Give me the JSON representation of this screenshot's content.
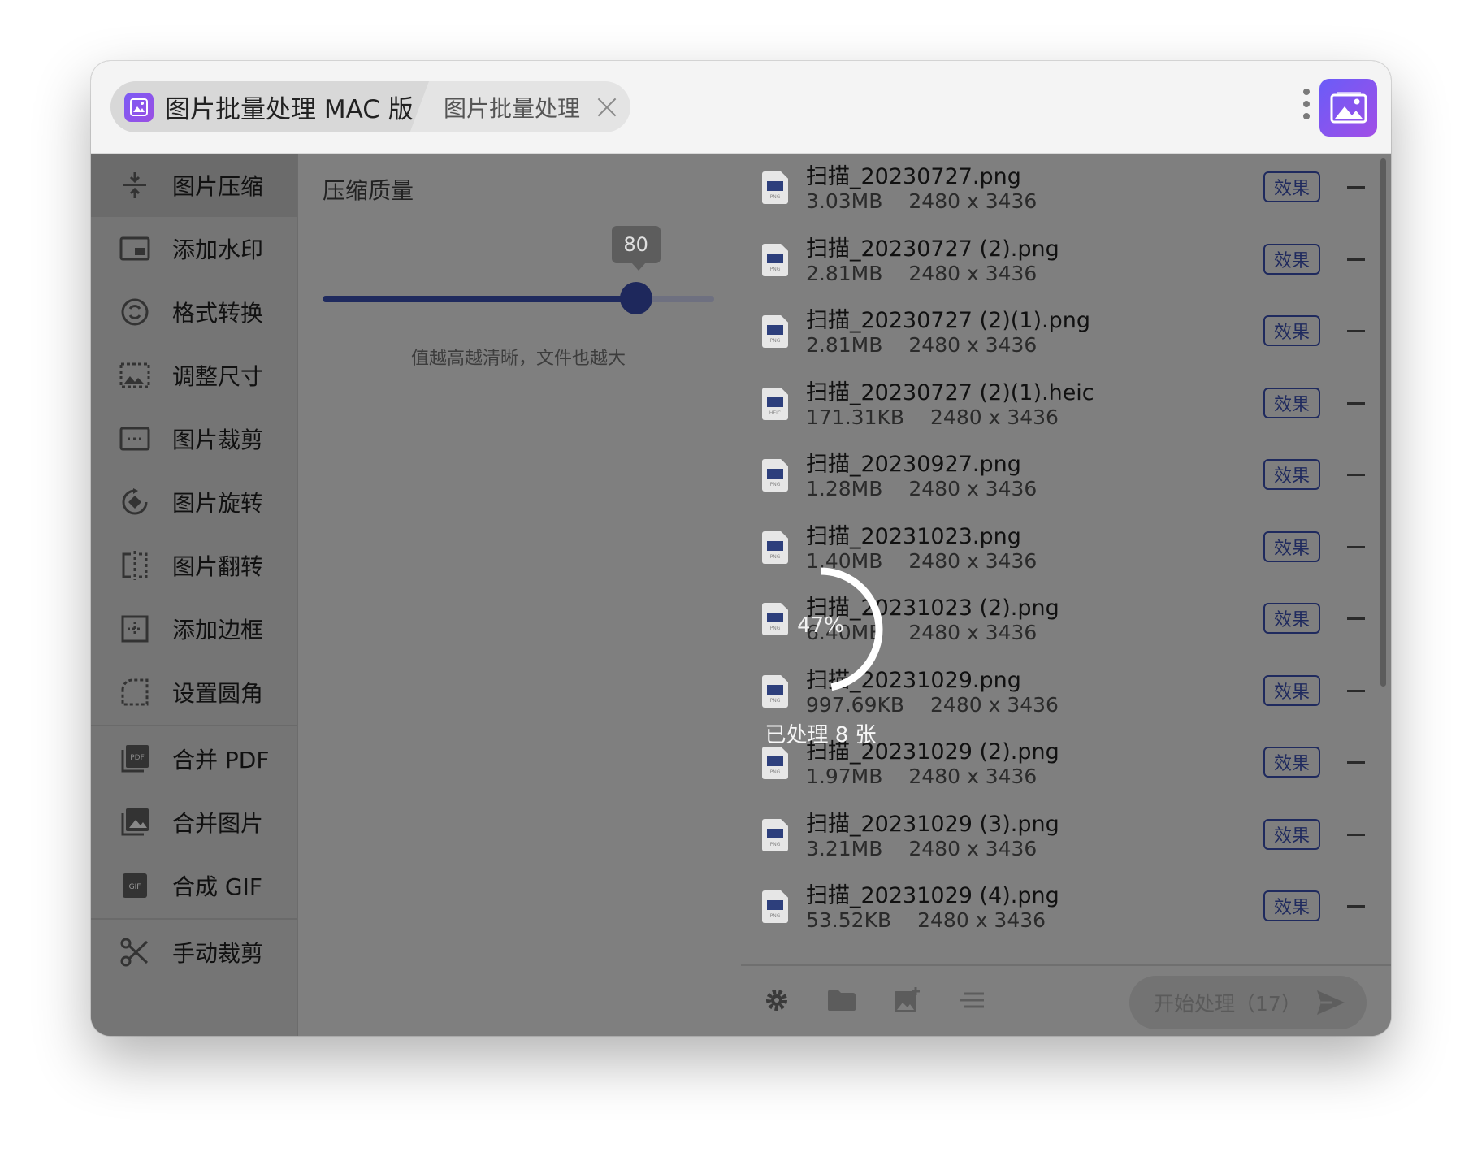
{
  "titlebar": {
    "app_tab_label": "图片批量处理 MAC 版",
    "second_tab_label": "图片批量处理"
  },
  "sidebar": {
    "items": [
      {
        "label": "图片压缩",
        "icon": "compress-icon",
        "active": true
      },
      {
        "label": "添加水印",
        "icon": "watermark-icon"
      },
      {
        "label": "格式转换",
        "icon": "convert-icon"
      },
      {
        "label": "调整尺寸",
        "icon": "resize-icon"
      },
      {
        "label": "图片裁剪",
        "icon": "crop-icon"
      },
      {
        "label": "图片旋转",
        "icon": "rotate-icon"
      },
      {
        "label": "图片翻转",
        "icon": "flip-icon"
      },
      {
        "label": "添加边框",
        "icon": "border-icon"
      },
      {
        "label": "设置圆角",
        "icon": "rounded-corner-icon"
      },
      {
        "label": "合并 PDF",
        "icon": "pdf-icon"
      },
      {
        "label": "合并图片",
        "icon": "merge-images-icon"
      },
      {
        "label": "合成 GIF",
        "icon": "gif-icon"
      },
      {
        "label": "手动裁剪",
        "icon": "scissors-icon"
      }
    ]
  },
  "panel": {
    "title": "压缩质量",
    "quality_value": "80",
    "quality_fraction": 0.8,
    "hint": "值越高越清晰，文件也越大"
  },
  "files": [
    {
      "name": "扫描_20230727.png",
      "size": "3.03MB",
      "dims": "2480 x 3436",
      "ext": "PNG"
    },
    {
      "name": "扫描_20230727 (2).png",
      "size": "2.81MB",
      "dims": "2480 x 3436",
      "ext": "PNG"
    },
    {
      "name": "扫描_20230727 (2)(1).png",
      "size": "2.81MB",
      "dims": "2480 x 3436",
      "ext": "PNG"
    },
    {
      "name": "扫描_20230727 (2)(1).heic",
      "size": "171.31KB",
      "dims": "2480 x 3436",
      "ext": "HEIC"
    },
    {
      "name": "扫描_20230927.png",
      "size": "1.28MB",
      "dims": "2480 x 3436",
      "ext": "PNG"
    },
    {
      "name": "扫描_20231023.png",
      "size": "1.40MB",
      "dims": "2480 x 3436",
      "ext": "PNG"
    },
    {
      "name": "扫描_20231023 (2).png",
      "size": "6.40MB",
      "dims": "2480 x 3436",
      "ext": "PNG"
    },
    {
      "name": "扫描_20231029.png",
      "size": "997.69KB",
      "dims": "2480 x 3436",
      "ext": "PNG"
    },
    {
      "name": "扫描_20231029 (2).png",
      "size": "1.97MB",
      "dims": "2480 x 3436",
      "ext": "PNG"
    },
    {
      "name": "扫描_20231029 (3).png",
      "size": "3.21MB",
      "dims": "2480 x 3436",
      "ext": "PNG"
    },
    {
      "name": "扫描_20231029 (4).png",
      "size": "53.52KB",
      "dims": "2480 x 3436",
      "ext": "PNG"
    }
  ],
  "file_effect_label": "效果",
  "bottom": {
    "start_label": "开始处理（17）",
    "tools": [
      "gear-icon",
      "folder-icon",
      "add-image-icon",
      "list-icon"
    ]
  },
  "progress": {
    "percent": "47%",
    "fraction": 0.47,
    "processed_label": "已处理 8 张"
  },
  "colors": {
    "accent": "#1f2a5e",
    "overlay": "#7f7f7f",
    "brand": "#7b5cf5"
  }
}
